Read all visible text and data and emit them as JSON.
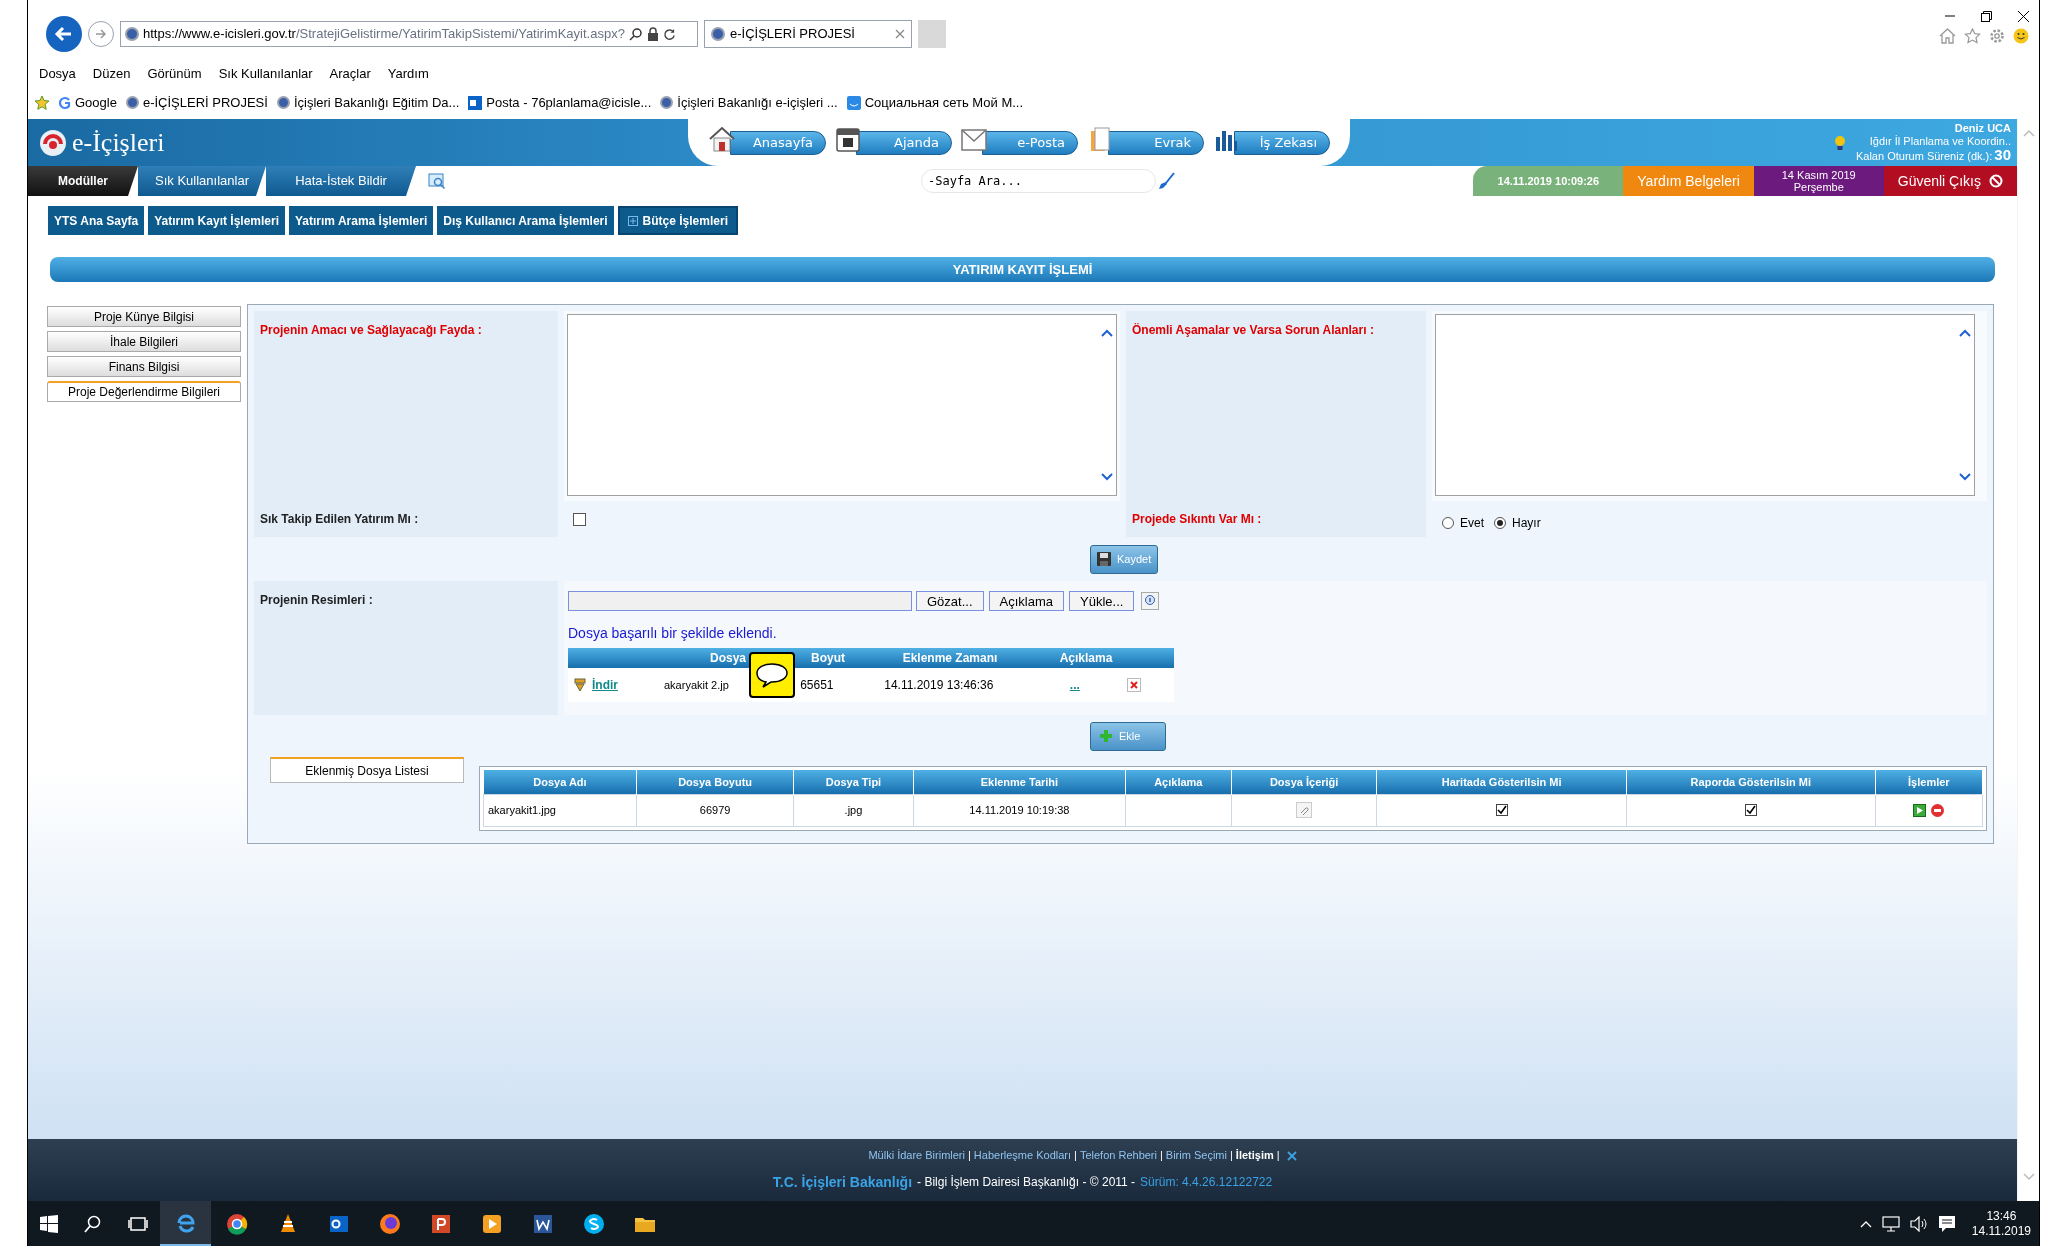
{
  "browser": {
    "url_host": "https://www.e-icisleri.gov.tr",
    "url_path": "/StratejiGelistirme/YatirimTakipSistemi/YatirimKayit.aspx?",
    "tab_title": "e-İÇİŞLERİ PROJESİ",
    "menu": [
      "Dosya",
      "Düzen",
      "Görünüm",
      "Sık Kullanılanlar",
      "Araçlar",
      "Yardım"
    ],
    "favorites": [
      {
        "label": "Google",
        "kind": "google"
      },
      {
        "label": "e-İÇİŞLERİ PROJESİ",
        "kind": "site"
      },
      {
        "label": "İçişleri Bakanlığı Eğitim Da...",
        "kind": "site"
      },
      {
        "label": "Posta - 76planlama@icisle...",
        "kind": "mail"
      },
      {
        "label": "İçişleri Bakanlığı e-içişleri ...",
        "kind": "site"
      },
      {
        "label": "Социальная сеть Мой М...",
        "kind": "social"
      }
    ]
  },
  "app": {
    "logo": "e-İçişleri",
    "nav": [
      {
        "label": "Anasayfa",
        "kind": "home"
      },
      {
        "label": "Ajanda",
        "kind": "calendar"
      },
      {
        "label": "e-Posta",
        "kind": "mail"
      },
      {
        "label": "Evrak",
        "kind": "document"
      },
      {
        "label": "İş Zekası",
        "kind": "chart"
      }
    ],
    "user": {
      "name": "Deniz UCA",
      "unit": "Iğdır İl Planlama ve Koordin..",
      "session_label": "Kalan Oturum Süreniz (dk.):",
      "session_value": "30"
    },
    "tabs": [
      {
        "label": "Modüller",
        "selected": true
      },
      {
        "label": "Sık Kullanılanlar",
        "selected": false
      },
      {
        "label": "Hata-İstek Bildir",
        "selected": false
      }
    ],
    "search": {
      "placeholder": "-Sayfa Ara..."
    },
    "info_tabs": [
      {
        "label": "14.11.2019 10:09:26",
        "color": "#79b27a"
      },
      {
        "label": "Yardım Belgeleri",
        "color": "#f0870f"
      },
      {
        "label": "14 Kasım 2019",
        "sublabel": "Perşembe",
        "color": "#6c1a7e"
      },
      {
        "label": "Güvenli Çıkış",
        "color": "#b30d22"
      }
    ]
  },
  "modules": [
    {
      "label": "YTS Ana Sayfa",
      "kind": "plain"
    },
    {
      "label": "Yatırım Kayıt İşlemleri",
      "kind": "plain"
    },
    {
      "label": "Yatırım Arama İşlemleri",
      "kind": "plain"
    },
    {
      "label": "Dış Kullanıcı Arama İşlemleri",
      "kind": "plain"
    },
    {
      "label": "Bütçe İşlemleri",
      "kind": "expandable"
    }
  ],
  "page_title": "YATIRIM KAYIT İŞLEMİ",
  "side_menu": [
    {
      "label": "Proje Künye Bilgisi",
      "selected": false
    },
    {
      "label": "İhale Bilgileri",
      "selected": false
    },
    {
      "label": "Finans Bilgisi",
      "selected": false
    },
    {
      "label": "Proje Değerlendirme Bilgileri",
      "selected": true
    }
  ],
  "form": {
    "purpose_label": "Projenin Amacı ve Sağlayacağı Fayda :",
    "stages_label": "Önemli Aşamalar ve Varsa Sorun Alanları :",
    "followed_label": "Sık Takip Edilen Yatırım Mı :",
    "followed_checked": false,
    "problem_label": "Projede Sıkıntı Var Mı :",
    "problem_options": [
      {
        "label": "Evet",
        "selected": false
      },
      {
        "label": "Hayır",
        "selected": true
      }
    ],
    "save_button": "Kaydet",
    "images_label": "Projenin Resimleri :",
    "upload_buttons": [
      "Gözat...",
      "Açıklama",
      "Yükle..."
    ],
    "success_message": "Dosya başarılı bir şekilde eklendi.",
    "upload_table": {
      "columns": [
        "Dosya",
        "Boyut",
        "Eklenme Zamanı",
        "Açıklama"
      ],
      "rows": [
        {
          "link": "İndir",
          "file": "akaryakit 2.jp",
          "size": "65651",
          "time": "14.11.2019 13:46:36",
          "note": "..."
        }
      ]
    },
    "add_button": "Ekle"
  },
  "files": {
    "tab": "Eklenmiş Dosya Listesi",
    "columns": [
      "Dosya Adı",
      "Dosya Boyutu",
      "Dosya Tipi",
      "Eklenme Tarihi",
      "Açıklama",
      "Dosya İçeriği",
      "Haritada Gösterilsin Mi",
      "Raporda Gösterilsin Mi",
      "İşlemler"
    ],
    "rows": [
      {
        "name": "akaryakit1.jpg",
        "size": "66979",
        "type": ".jpg",
        "date": "14.11.2019 10:19:38",
        "map": true,
        "report": true
      }
    ]
  },
  "footer": {
    "links": [
      "Mülki İdare Birimleri",
      "Haberleşme Kodları",
      "Telefon Rehberi",
      "Birim Seçimi",
      "İletişim"
    ],
    "separator": "|",
    "org": "T.C. İçişleri Bakanlığı",
    "text": "- Bilgi İşlem Dairesi Başkanlığı - © 2011  -",
    "version": "Sürüm: 4.4.26.12122722"
  },
  "taskbar": {
    "time": "13:46",
    "date": "14.11.2019"
  }
}
